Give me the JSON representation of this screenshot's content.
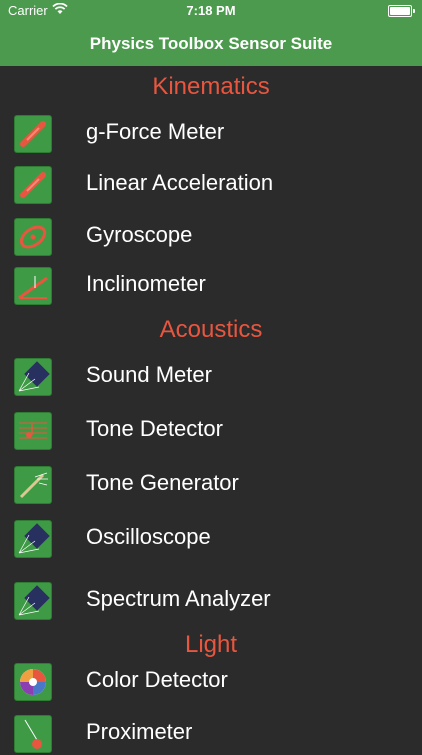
{
  "status": {
    "carrier": "Carrier",
    "time": "7:18 PM"
  },
  "nav": {
    "title": "Physics Toolbox Sensor Suite"
  },
  "sections": [
    {
      "title": "Kinematics",
      "items": [
        {
          "label": "g-Force Meter",
          "icon": "accelerometer-icon"
        },
        {
          "label": "Linear Acceleration",
          "icon": "linear-acceleration-icon"
        },
        {
          "label": "Gyroscope",
          "icon": "gyroscope-icon"
        },
        {
          "label": "Inclinometer",
          "icon": "inclinometer-icon"
        }
      ]
    },
    {
      "title": "Acoustics",
      "items": [
        {
          "label": "Sound Meter",
          "icon": "sound-meter-icon"
        },
        {
          "label": "Tone Detector",
          "icon": "tone-detector-icon"
        },
        {
          "label": "Tone Generator",
          "icon": "tone-generator-icon"
        },
        {
          "label": "Oscilloscope",
          "icon": "oscilloscope-icon"
        },
        {
          "label": "Spectrum Analyzer",
          "icon": "spectrum-analyzer-icon"
        }
      ]
    },
    {
      "title": "Light",
      "items": [
        {
          "label": "Color Detector",
          "icon": "color-detector-icon"
        },
        {
          "label": "Proximeter",
          "icon": "proximeter-icon"
        }
      ]
    }
  ]
}
